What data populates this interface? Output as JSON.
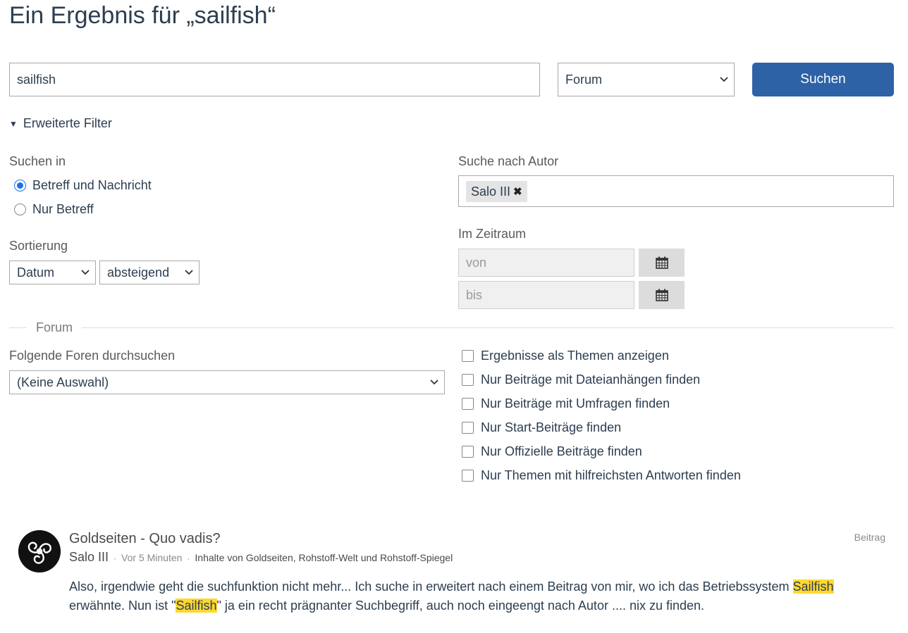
{
  "page": {
    "title": "Ein Ergebnis für „sailfish“"
  },
  "search": {
    "query": "sailfish",
    "scope_selected": "Forum",
    "submit_label": "Suchen"
  },
  "filters": {
    "toggle_label": "Erweiterte Filter",
    "search_in_label": "Suchen in",
    "search_in_options": [
      {
        "label": "Betreff und Nachricht",
        "checked": true
      },
      {
        "label": "Nur Betreff",
        "checked": false
      }
    ],
    "sort_label": "Sortierung",
    "sort_field": "Datum",
    "sort_order": "absteigend",
    "author_label": "Suche nach Autor",
    "author_tag": "Salo III",
    "period_label": "Im Zeitraum",
    "from_placeholder": "von",
    "to_placeholder": "bis"
  },
  "forum": {
    "legend": "Forum",
    "forums_label": "Folgende Foren durchsuchen",
    "forums_selected": "(Keine Auswahl)",
    "checkboxes": [
      {
        "label": "Ergebnisse als Themen anzeigen",
        "checked": false
      },
      {
        "label": "Nur Beiträge mit Dateianhängen finden",
        "checked": false
      },
      {
        "label": "Nur Beiträge mit Umfragen finden",
        "checked": false
      },
      {
        "label": "Nur Start-Beiträge finden",
        "checked": false
      },
      {
        "label": "Nur Offizielle Beiträge finden",
        "checked": false
      },
      {
        "label": "Nur Themen mit hilfreichsten Antworten finden",
        "checked": false
      }
    ]
  },
  "result": {
    "title": "Goldseiten - Quo vadis?",
    "type": "Beitrag",
    "author": "Salo III",
    "time": "Vor 5 Minuten",
    "board": "Inhalte von Goldseiten, Rohstoff-Welt und Rohstoff-Spiegel",
    "excerpt_part1": "Also, irgendwie geht die suchfunktion nicht mehr... Ich suche in erweitert nach einem Beitrag von mir, wo ich das Betriebssystem ",
    "highlight1": "Sailfish",
    "excerpt_part2": " erwähnte. Nun ist \"",
    "highlight2": "Sailfish",
    "excerpt_part3": "\" ja ein recht prägnanter Suchbegriff, auch noch eingeengt nach Autor .... nix zu finden."
  },
  "colors": {
    "primary": "#2d62a6",
    "highlight": "#ffd830",
    "text": "#2c3e50"
  },
  "icons": {
    "calendar": "calendar-icon",
    "remove": "remove-tag-icon",
    "avatar": "triskelion-avatar"
  }
}
